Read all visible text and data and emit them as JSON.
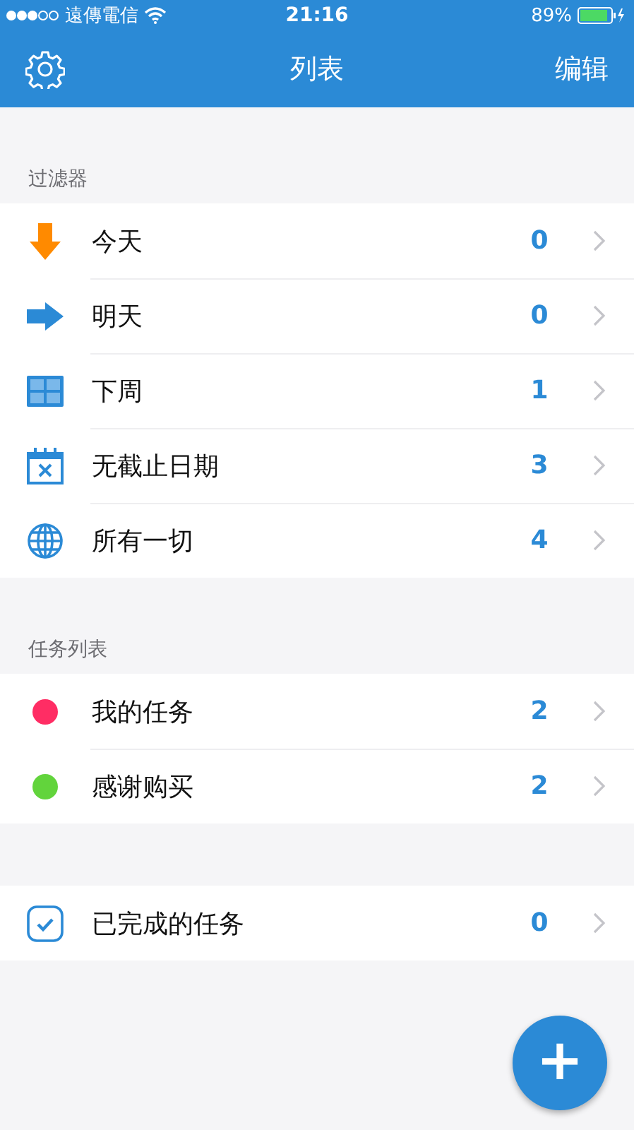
{
  "status_bar": {
    "carrier": "遠傳電信",
    "time": "21:16",
    "battery": "89%"
  },
  "nav_bar": {
    "title": "列表",
    "edit": "编辑"
  },
  "filters": {
    "header": "过滤器",
    "items": [
      {
        "kind": "down-arrow",
        "label": "今天",
        "count": "0"
      },
      {
        "kind": "right-arrow",
        "label": "明天",
        "count": "0"
      },
      {
        "kind": "grid",
        "label": "下周",
        "count": "1"
      },
      {
        "kind": "calendar",
        "label": "无截止日期",
        "count": "3"
      },
      {
        "kind": "globe",
        "label": "所有一切",
        "count": "4"
      }
    ]
  },
  "task_lists": {
    "header": "任务列表",
    "items": [
      {
        "label": "我的任务",
        "count": "2",
        "color": "#ff2d64"
      },
      {
        "label": "感谢购买",
        "count": "2",
        "color": "#62d43c"
      }
    ]
  },
  "completed": {
    "items": [
      {
        "kind": "check",
        "label": "已完成的任务",
        "count": "0"
      }
    ]
  },
  "fab": {
    "label": "+"
  }
}
